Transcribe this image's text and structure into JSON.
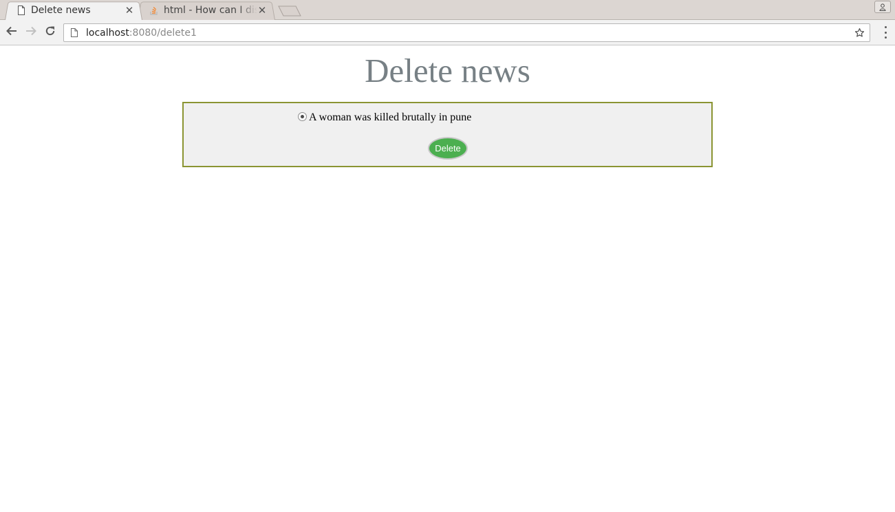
{
  "browser": {
    "tabs": [
      {
        "title": "Delete news",
        "icon": "document-icon",
        "active": true
      },
      {
        "title": "html - How can I dis",
        "icon": "stackoverflow-icon",
        "active": false
      }
    ],
    "address_bar": {
      "host": "localhost",
      "rest": ":8080/delete1"
    }
  },
  "page": {
    "heading": "Delete news",
    "news_items": [
      {
        "label": "A woman was killed brutally in pune",
        "selected": true
      }
    ],
    "delete_button": "Delete"
  },
  "colors": {
    "heading": "#778085",
    "box_border": "#8a9432",
    "box_background": "#f0f0f0",
    "button": "#4caf50"
  }
}
